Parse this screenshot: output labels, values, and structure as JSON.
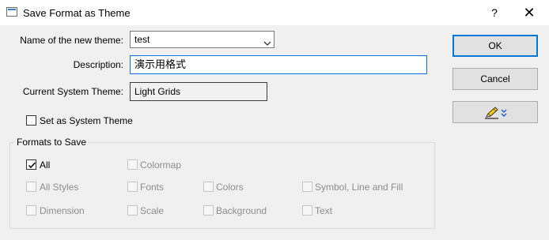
{
  "window": {
    "title": "Save Format as Theme",
    "help": "?",
    "close": "✕"
  },
  "form": {
    "name_label": "Name of the new theme:",
    "name_value": "test",
    "description_label": "Description:",
    "description_value": "演示用格式",
    "current_theme_label": "Current System Theme:",
    "current_theme_value": "Light Grids",
    "set_system_label": "Set as System Theme"
  },
  "buttons": {
    "ok": "OK",
    "cancel": "Cancel"
  },
  "formats": {
    "group_label": "Formats to Save",
    "all": "All",
    "colormap": "Colormap",
    "all_styles": "All Styles",
    "fonts": "Fonts",
    "colors": "Colors",
    "symbol_line_fill": "Symbol, Line and Fill",
    "dimension": "Dimension",
    "scale": "Scale",
    "background": "Background",
    "text": "Text"
  },
  "icons": {
    "pencil": "pencil-icon",
    "double_chevron": "double-chevron-down-icon"
  },
  "colors": {
    "accent": "#0078d7",
    "pencil_yellow": "#ffd200"
  }
}
